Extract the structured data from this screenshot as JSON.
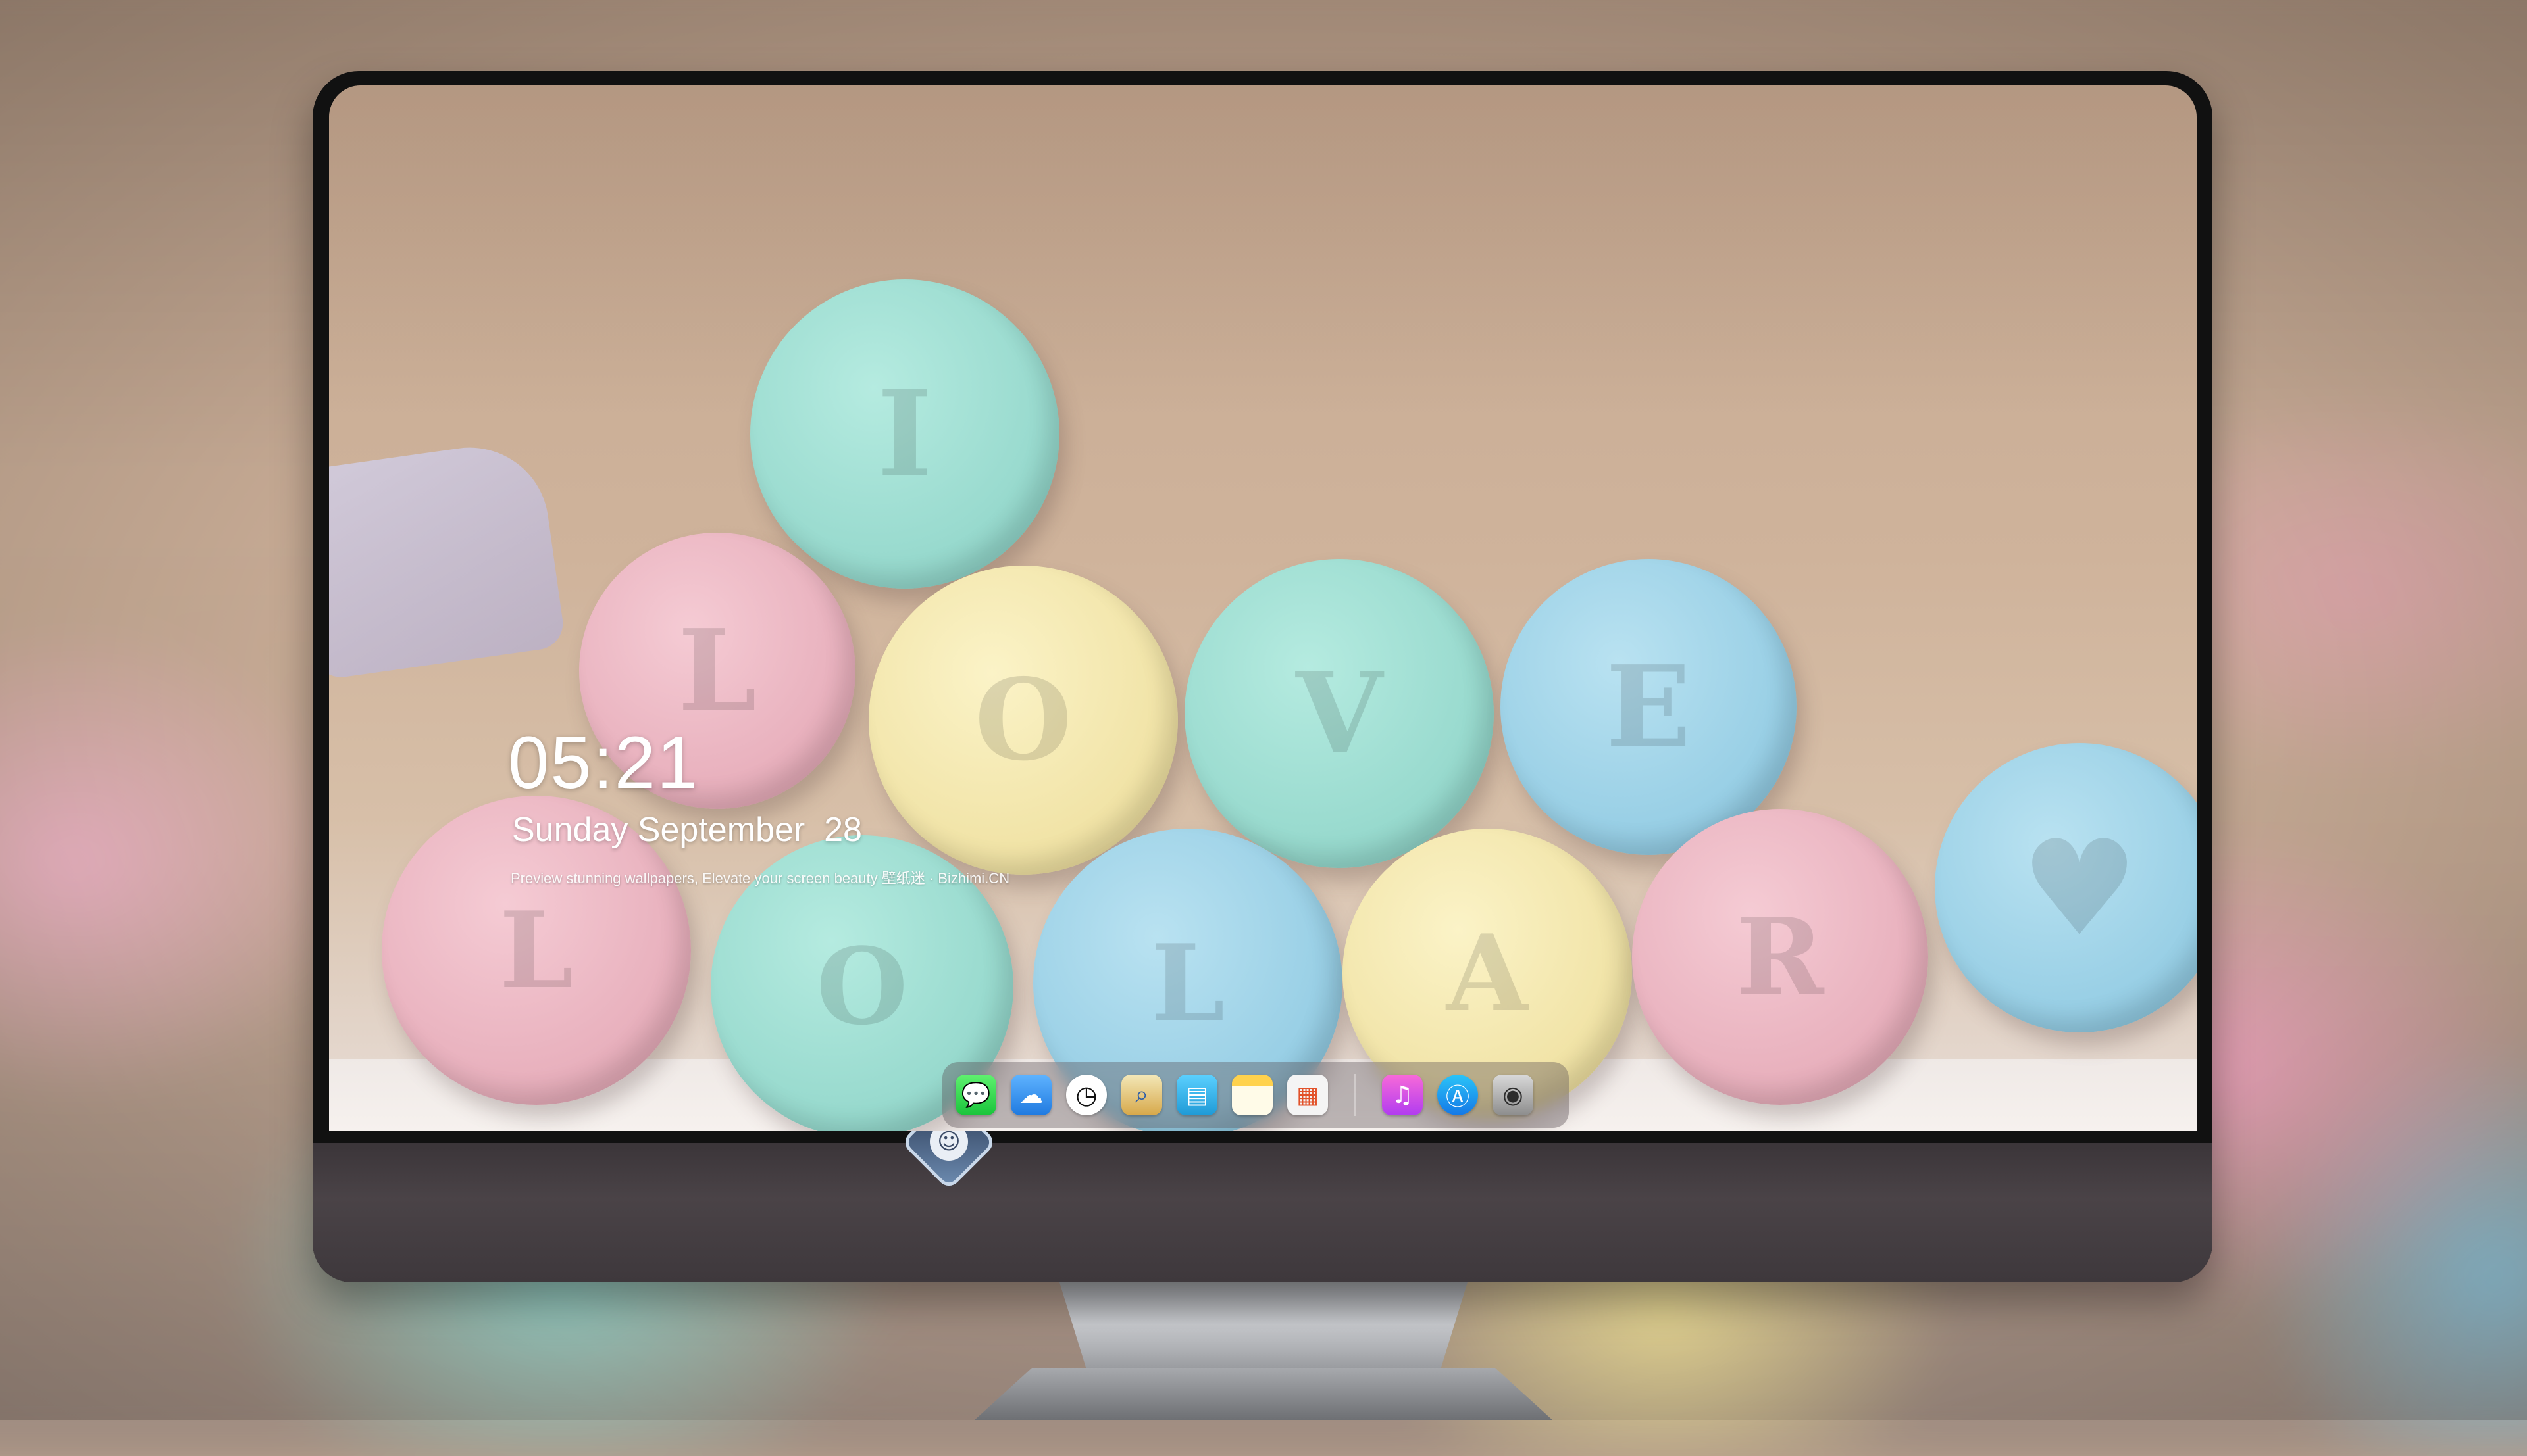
{
  "lockscreen": {
    "time": "05:21",
    "date": "Sunday September  28",
    "tagline": "Preview stunning wallpapers, Elevate your screen beauty  壁纸迷 · Bizhimi.CN"
  },
  "dock": {
    "apps": [
      {
        "name": "Messages",
        "icon": "messages-icon"
      },
      {
        "name": "Weather",
        "icon": "weather-icon"
      },
      {
        "name": "Clock",
        "icon": "clock-icon"
      },
      {
        "name": "Preview",
        "icon": "preview-icon"
      },
      {
        "name": "Videos",
        "icon": "clapperboard-icon"
      },
      {
        "name": "Notes",
        "icon": "notes-icon"
      },
      {
        "name": "Photos",
        "icon": "photos-icon"
      },
      {
        "name": "Music",
        "icon": "music-icon"
      },
      {
        "name": "App Store",
        "icon": "app-store-icon"
      },
      {
        "name": "Camera",
        "icon": "camera-icon"
      }
    ]
  },
  "wallpaper": {
    "subject": "pastel chalk pieces"
  },
  "colors": {
    "pink": "#e7aebb",
    "mint": "#95d8cc",
    "yellow": "#f0e2a4",
    "blue": "#95cde4",
    "chin": "#4a4347"
  }
}
